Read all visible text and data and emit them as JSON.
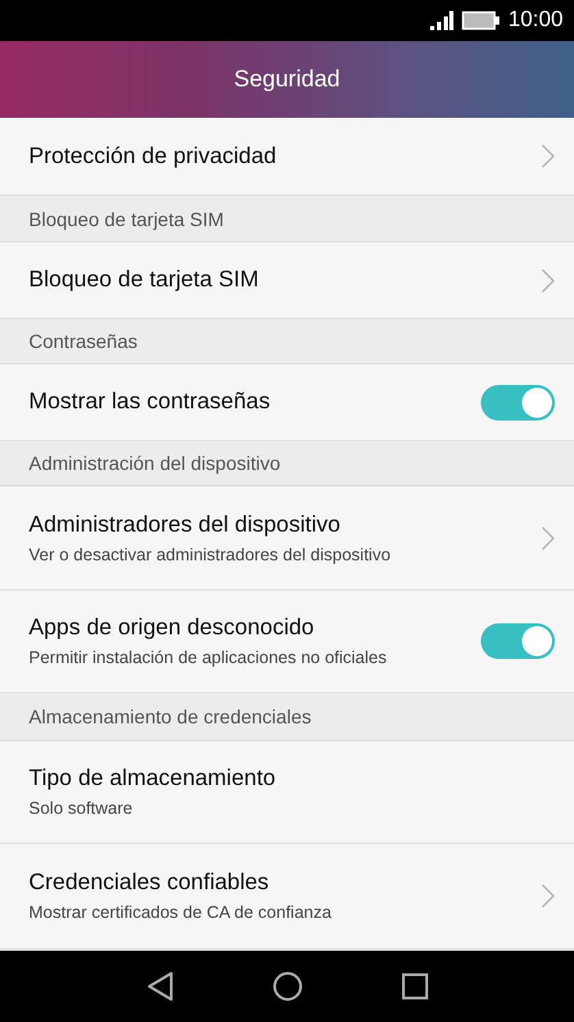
{
  "status_bar": {
    "time": "10:00"
  },
  "header": {
    "title": "Seguridad"
  },
  "rows": [
    {
      "kind": "link",
      "title": "Protección de privacidad"
    },
    {
      "kind": "section",
      "title": "Bloqueo de tarjeta SIM"
    },
    {
      "kind": "link",
      "title": "Bloqueo de tarjeta SIM"
    },
    {
      "kind": "section",
      "title": "Contraseñas"
    },
    {
      "kind": "toggle",
      "title": "Mostrar las contraseñas",
      "on": true
    },
    {
      "kind": "section",
      "title": "Administración del dispositivo"
    },
    {
      "kind": "link",
      "title": "Administradores del dispositivo",
      "subtitle": "Ver o desactivar administradores del dispositivo"
    },
    {
      "kind": "toggle",
      "title": "Apps de origen desconocido",
      "subtitle": "Permitir instalación de aplicaciones no oficiales",
      "on": true
    },
    {
      "kind": "section",
      "title": "Almacenamiento de credenciales"
    },
    {
      "kind": "info",
      "title": "Tipo de almacenamiento",
      "subtitle": "Solo software"
    },
    {
      "kind": "link",
      "title": "Credenciales confiables",
      "subtitle": "Mostrar certificados de CA de confianza"
    }
  ]
}
